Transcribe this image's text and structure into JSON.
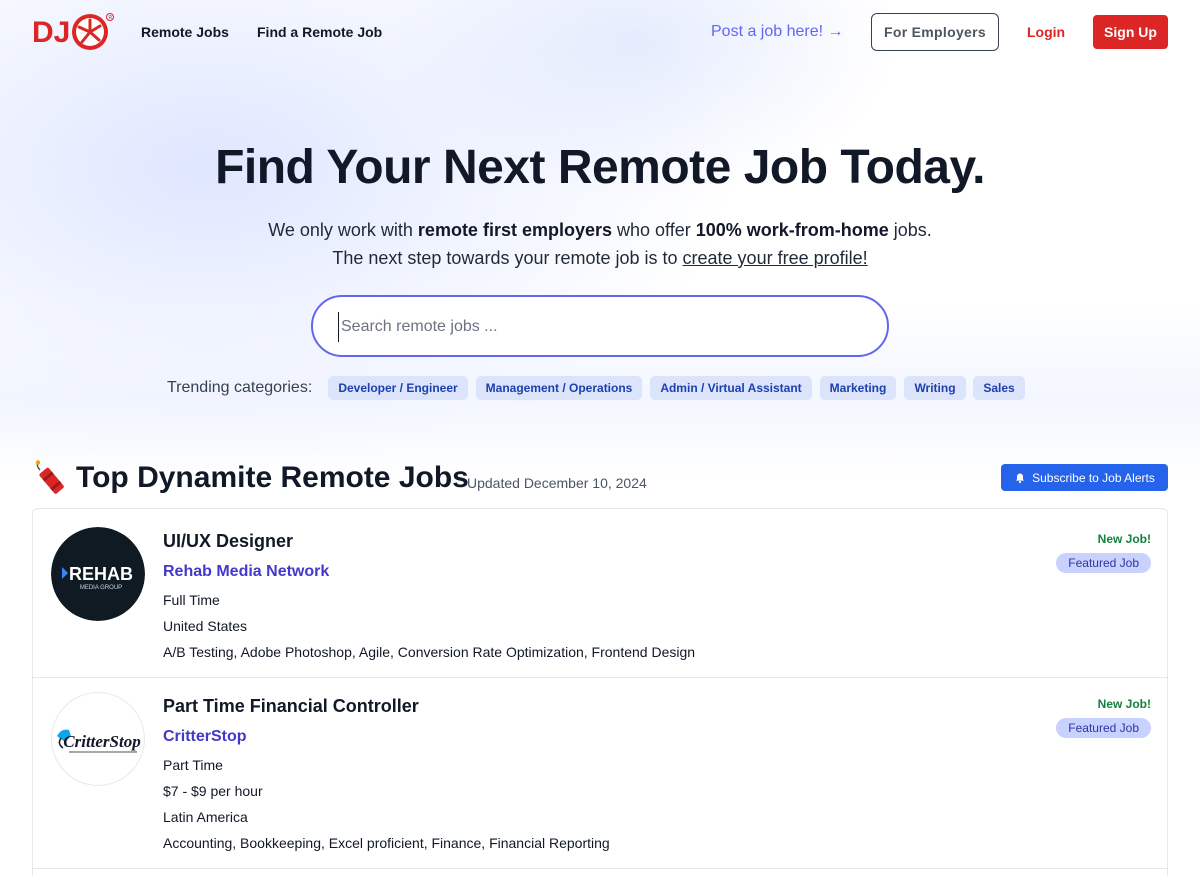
{
  "header": {
    "logo_text": "DJ",
    "nav": [
      "Remote Jobs",
      "Find a Remote Job"
    ],
    "post_job": "Post a job here! →",
    "for_employers": "For Employers",
    "login": "Login",
    "signup": "Sign Up"
  },
  "hero": {
    "title": "Find Your Next Remote Job Today.",
    "line1_a": "We only work with ",
    "line1_b": "remote first employers",
    "line1_c": " who offer ",
    "line1_d": "100% work-from-home",
    "line1_e": " jobs.",
    "line2_a": "The next step towards your remote job is to ",
    "line2_link": "create your free profile!",
    "search_placeholder": "Search remote jobs ...",
    "trending_label": "Trending categories:",
    "categories": [
      "Developer / Engineer",
      "Management / Operations",
      "Admin / Virtual Assistant",
      "Marketing",
      "Writing",
      "Sales"
    ]
  },
  "top_jobs": {
    "title": "Top Dynamite Remote Jobs",
    "updated": "Updated December 10, 2024",
    "subscribe": "Subscribe to Job Alerts"
  },
  "jobs": [
    {
      "title": "UI/UX Designer",
      "company": "Rehab Media Network",
      "logo_text": "REHAB",
      "logo_sub": "MEDIA GROUP",
      "lines": [
        "Full Time",
        "United States",
        "A/B Testing, Adobe Photoshop, Agile, Conversion Rate Optimization, Frontend Design"
      ],
      "new_label": "New Job!",
      "featured_label": "Featured Job"
    },
    {
      "title": "Part Time Financial Controller",
      "company": "CritterStop",
      "logo_text": "CritterStop",
      "lines": [
        "Part Time",
        "$7 - $9 per hour",
        "Latin America",
        "Accounting, Bookkeeping, Excel proficient, Finance, Financial Reporting"
      ],
      "new_label": "New Job!",
      "featured_label": "Featured Job"
    }
  ],
  "colors": {
    "brand_red": "#dc2626",
    "accent_indigo": "#6366f1",
    "subscribe_blue": "#2563eb",
    "new_green": "#15803d"
  }
}
